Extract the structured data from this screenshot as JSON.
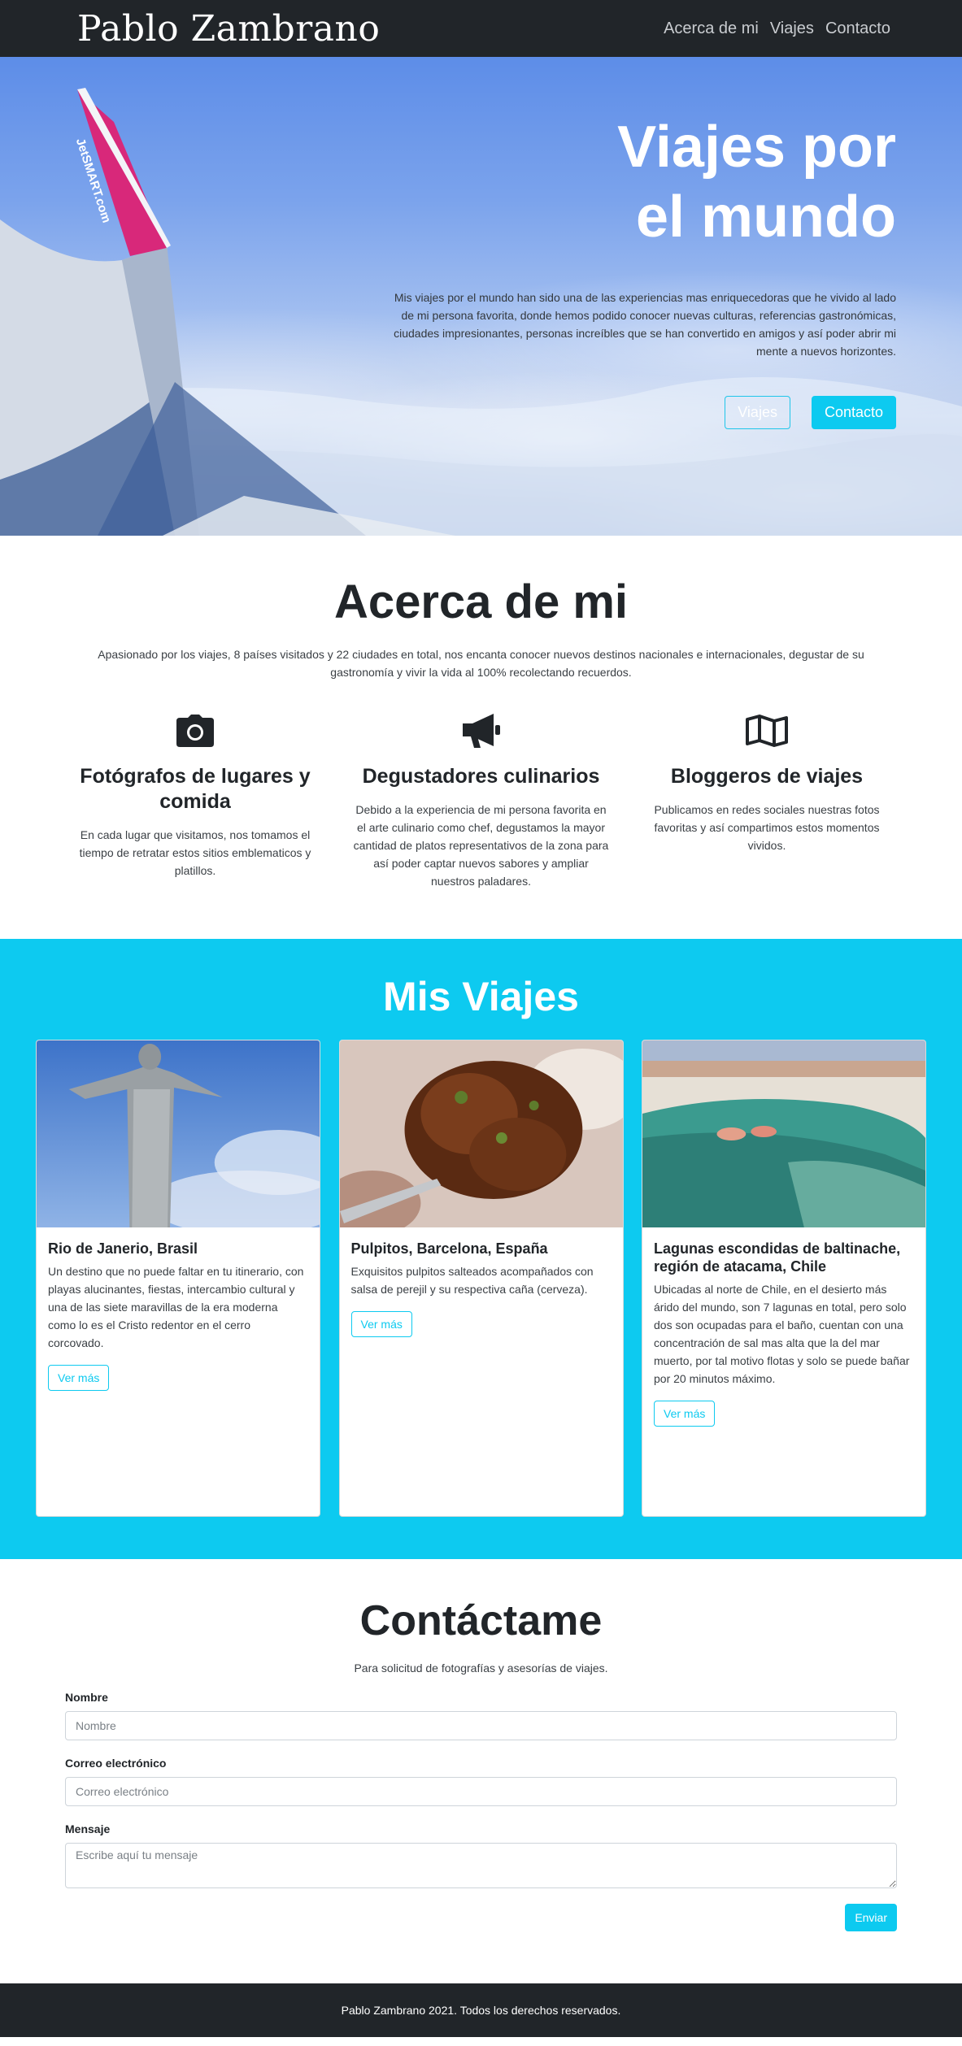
{
  "navbar": {
    "brand": "Pablo Zambrano",
    "links": [
      "Acerca de mi",
      "Viajes",
      "Contacto"
    ]
  },
  "hero": {
    "title_line1": "Viajes por",
    "title_line2": "el mundo",
    "text": "Mis viajes por el mundo han sido una de las experiencias mas enriquecedoras que he vivido al lado de mi persona favorita, donde hemos podido conocer nuevas culturas, referencias gastronómicas, ciudades impresionantes, personas increíbles que se han convertido en amigos y así poder abrir mi mente a nuevos horizontes.",
    "buttons": [
      "Viajes",
      "Contacto"
    ],
    "wing_logo": "JetSMART.com"
  },
  "about": {
    "title": "Acerca de mi",
    "lead": "Apasionado por los viajes, 8 países visitados y 22 ciudades en total, nos encanta conocer nuevos destinos nacionales e internacionales, degustar de su gastronomía y vivir la vida al 100% recolectando recuerdos.",
    "features": [
      {
        "icon": "camera-icon",
        "title": "Fotógrafos de lugares y comida",
        "text": "En cada lugar que visitamos, nos tomamos el tiempo de retratar estos sitios emblematicos y platillos."
      },
      {
        "icon": "megaphone-icon",
        "title": "Degustadores culinarios",
        "text": "Debido a la experiencia de mi persona favorita en el arte culinario como chef, degustamos la mayor cantidad de platos representativos de la zona para así poder captar nuevos sabores y ampliar nuestros paladares."
      },
      {
        "icon": "map-icon",
        "title": "Bloggeros de viajes",
        "text": "Publicamos en redes sociales nuestras fotos favoritas y así compartimos estos momentos vividos."
      }
    ]
  },
  "travels": {
    "title": "Mis Viajes",
    "cards": [
      {
        "title": "Rio de Janerio, Brasil",
        "text": "Un destino que no puede faltar en tu itinerario, con playas alucinantes, fiestas, intercambio cultural y una de las siete maravillas de la era moderna como lo es el Cristo redentor en el cerro corcovado.",
        "button": "Ver más"
      },
      {
        "title": "Pulpitos, Barcelona, España",
        "text": "Exquisitos pulpitos salteados acompañados con salsa de perejil y su respectiva caña (cerveza).",
        "button": "Ver más"
      },
      {
        "title": "Lagunas escondidas de baltinache, región de atacama, Chile",
        "text": "Ubicadas al norte de Chile, en el desierto más árido del mundo, son 7 lagunas en total, pero solo dos son ocupadas para el baño, cuentan con una concentración de sal mas alta que la del mar muerto, por tal motivo flotas y solo se puede bañar por 20 minutos máximo.",
        "button": "Ver más"
      }
    ]
  },
  "contact": {
    "title": "Contáctame",
    "lead": "Para solicitud de fotografías y asesorías de viajes.",
    "name_label": "Nombre",
    "name_placeholder": "Nombre",
    "email_label": "Correo electrónico",
    "email_placeholder": "Correo electrónico",
    "message_label": "Mensaje",
    "message_placeholder": "Escribe aquí tu mensaje",
    "submit": "Enviar"
  },
  "footer": {
    "text": "Pablo Zambrano 2021. Todos los derechos reservados."
  },
  "colors": {
    "dark": "#212529",
    "accent": "#0dcaf0",
    "white": "#ffffff"
  }
}
